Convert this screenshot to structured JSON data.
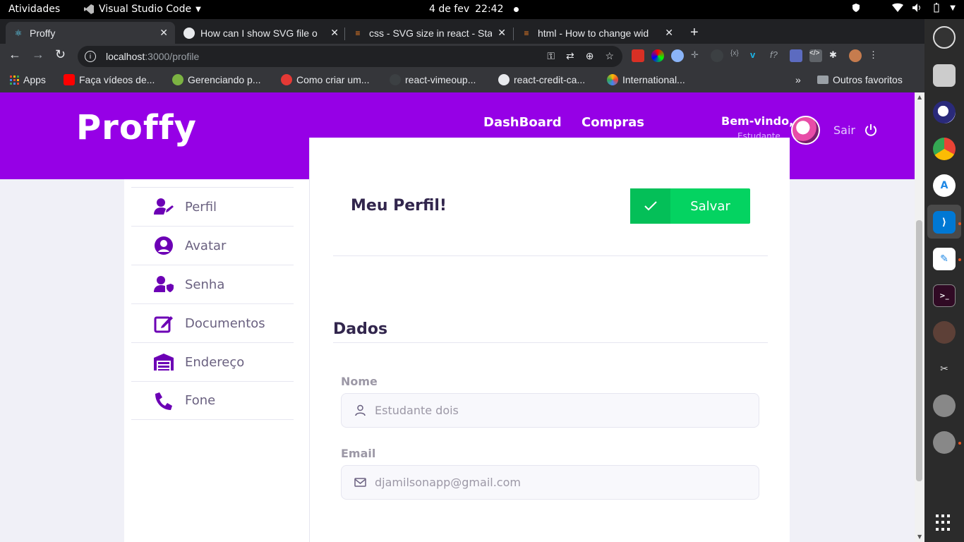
{
  "system_bar": {
    "activities": "Atividades",
    "app_name": "Visual Studio Code",
    "date": "4 de fev",
    "time": "22:42"
  },
  "browser": {
    "tabs": [
      {
        "label": "Proffy",
        "active": true,
        "icon": "react-icon"
      },
      {
        "label": "How can I show SVG file o",
        "active": false,
        "icon": "github-icon"
      },
      {
        "label": "css - SVG size in react - Sta",
        "active": false,
        "icon": "stackoverflow-icon"
      },
      {
        "label": "html - How to change wid",
        "active": false,
        "icon": "stackoverflow-icon"
      }
    ],
    "url_host": "localhost",
    "url_path": ":3000/profile",
    "bookmarks": [
      {
        "label": "Apps",
        "icon": "apps-grid-icon"
      },
      {
        "label": "Faça vídeos de...",
        "icon": "youtube-icon"
      },
      {
        "label": "Gerenciando p...",
        "icon": "leaf-icon"
      },
      {
        "label": "Como criar um...",
        "icon": "fire-icon"
      },
      {
        "label": "react-vimeoup...",
        "icon": "github-icon"
      },
      {
        "label": "react-credit-ca...",
        "icon": "globe-icon"
      },
      {
        "label": "International...",
        "icon": "nbc-icon"
      }
    ],
    "bookmarks_overflow": "»",
    "other_bookmarks": "Outros favoritos"
  },
  "app": {
    "logo": "Proffy",
    "nav": [
      "DashBoard",
      "Compras"
    ],
    "welcome": "Bem-vindo,",
    "welcome_sub": "Estudante",
    "logout": "Sair",
    "sidebar": [
      {
        "label": "Perfil",
        "icon": "user-edit-icon"
      },
      {
        "label": "Avatar",
        "icon": "user-circle-icon"
      },
      {
        "label": "Senha",
        "icon": "user-shield-icon"
      },
      {
        "label": "Documentos",
        "icon": "edit-icon"
      },
      {
        "label": "Endereço",
        "icon": "warehouse-icon"
      },
      {
        "label": "Fone",
        "icon": "phone-icon"
      }
    ],
    "card_title": "Meu Perfil!",
    "save_label": "Salvar",
    "section_title": "Dados",
    "fields": [
      {
        "label": "Nome",
        "value": "Estudante dois",
        "icon": "user-outline-icon"
      },
      {
        "label": "Email",
        "value": "djamilsonapp@gmail.com",
        "icon": "mail-icon"
      }
    ]
  },
  "colors": {
    "brand": "#9600e6",
    "menu_icon": "#6c00b5",
    "save_green": "#04d361",
    "title": "#32264d"
  }
}
